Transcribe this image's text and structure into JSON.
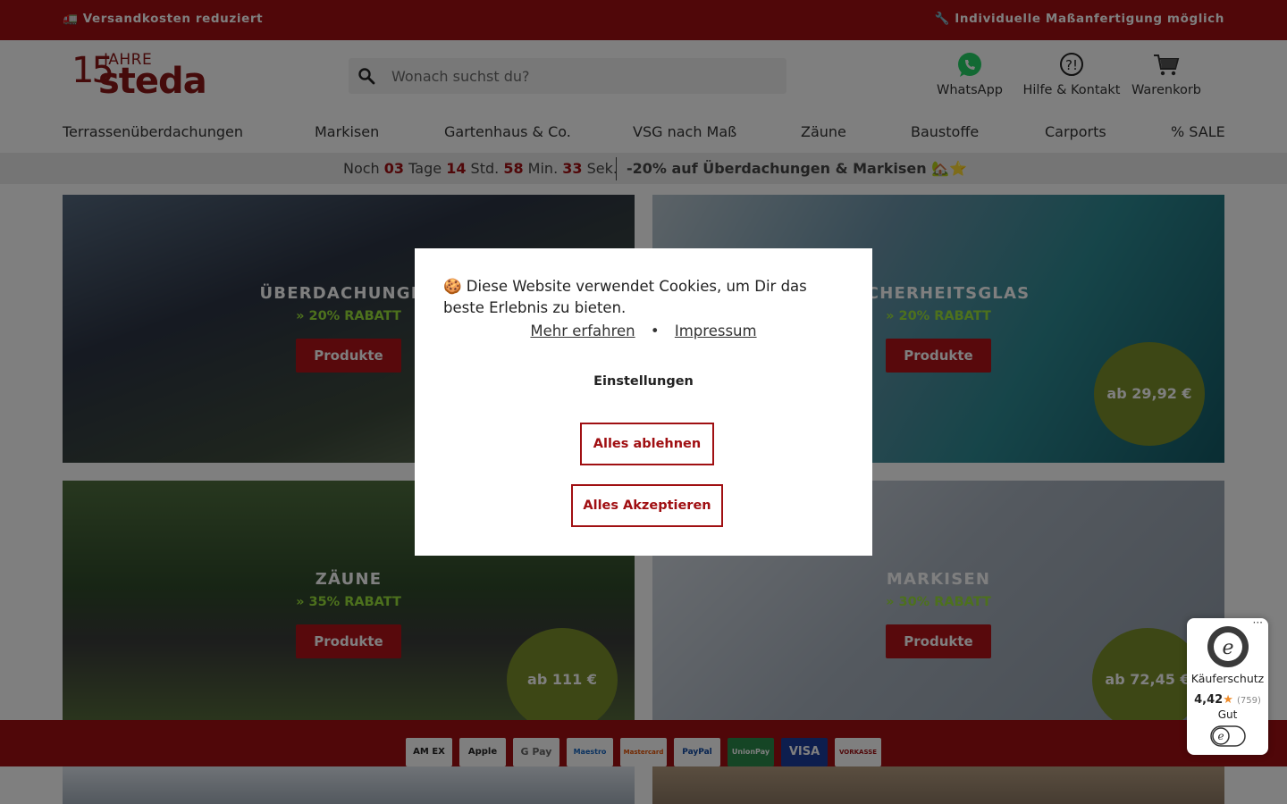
{
  "topbar": {
    "left": "🚛 Versandkosten reduziert",
    "right": "🔧 Individuelle Maßanfertigung möglich"
  },
  "logo": {
    "number": "15",
    "jahre": "JAHRE",
    "brand": "steda"
  },
  "search": {
    "placeholder": "Wonach suchst du?",
    "icon": "search-icon"
  },
  "header_icons": {
    "whatsapp": "WhatsApp",
    "help": "Hilfe & Kontakt",
    "cart": "Warenkorb"
  },
  "nav": [
    "Terrassenüberdachungen",
    "Markisen",
    "Gartenhaus & Co.",
    "VSG nach Maß",
    "Zäune",
    "Baustoffe",
    "Carports",
    "% SALE"
  ],
  "promo": {
    "noch": "Noch",
    "days": "03",
    "days_label": "Tage",
    "hours": "14",
    "hours_label": "Std.",
    "minutes": "58",
    "minutes_label": "Min.",
    "seconds": "33",
    "seconds_label": "Sek.",
    "message": "-20% auf Überdachungen & Markisen 🏡⭐"
  },
  "tiles": [
    {
      "title": "ÜBERDACHUNGEN",
      "rebate": "» 20% RABATT",
      "button": "Produkte",
      "price": ""
    },
    {
      "title": "SICHERHEITSGLAS",
      "rebate": "» 20% RABATT",
      "button": "Produkte",
      "price": "ab 29,92 €"
    },
    {
      "title": "ZÄUNE",
      "rebate": "» 35% RABATT",
      "button": "Produkte",
      "price": "ab 111 €"
    },
    {
      "title": "MARKISEN",
      "rebate": "» 30% RABATT",
      "button": "Produkte",
      "price": "ab 72,45 €"
    }
  ],
  "payment": [
    "AM EX",
    "Apple Pay",
    "G Pay",
    "Maestro",
    "Mastercard",
    "PayPal",
    "UnionPay",
    "VISA",
    "VORKASSE"
  ],
  "cookie": {
    "text": "🍪 Diese Website verwendet Cookies, um Dir das beste Erlebnis zu bieten.",
    "more": "Mehr erfahren",
    "dot": "•",
    "impressum": "Impressum",
    "settings": "Einstellungen",
    "reject": "Alles ablehnen",
    "accept": "Alles Akzeptieren"
  },
  "trusted_shops": {
    "menu": "···",
    "label": "Käuferschutz",
    "score": "4,42",
    "star": "★",
    "count": "(759)",
    "grade": "Gut"
  },
  "colors": {
    "brand_red": "#a00f12",
    "rebate_green": "#9be23a",
    "price_circle": "#7a8f2a"
  }
}
